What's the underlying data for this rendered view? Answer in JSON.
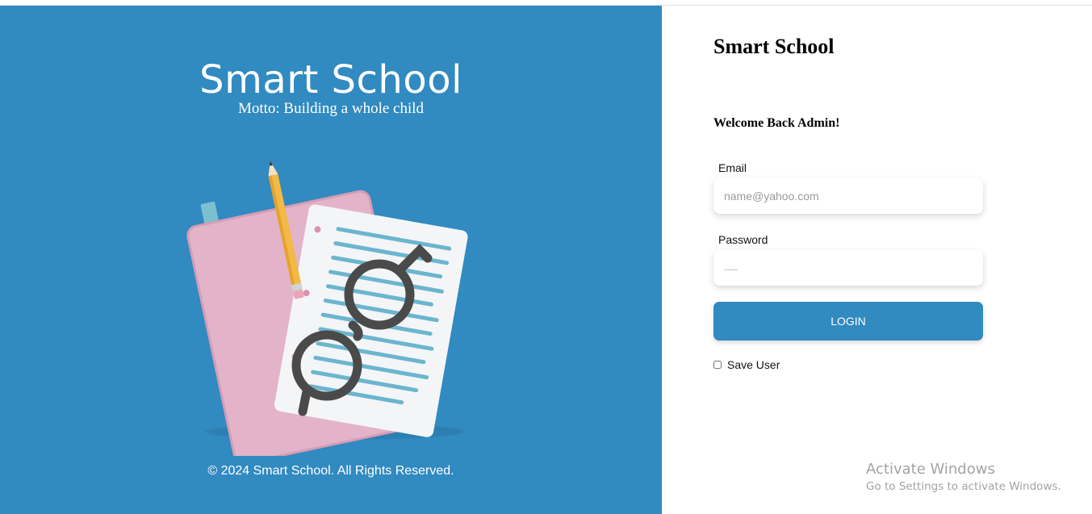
{
  "brand": {
    "title": "Smart School",
    "motto": "Motto: Building a whole child",
    "copyright": "© 2024 Smart School. All Rights Reserved."
  },
  "login": {
    "app_title": "Smart School",
    "welcome": "Welcome Back Admin!",
    "email_label": "Email",
    "email_placeholder": "name@yahoo.com",
    "password_label": "Password",
    "password_value": "........",
    "login_button": "LOGIN",
    "save_user_label": "Save User",
    "save_user_checked": false
  },
  "watermark": {
    "title": "Activate Windows",
    "subtitle": "Go to Settings to activate Windows."
  },
  "colors": {
    "brand_blue": "#318ac0",
    "notebook_pink": "#e3b4c9",
    "paper_lines": "#6bb5cf"
  }
}
